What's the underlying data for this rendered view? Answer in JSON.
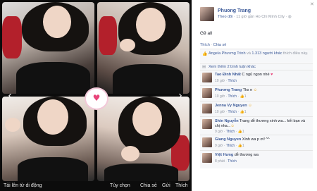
{
  "viewer": {
    "prev_arrow": "‹",
    "next_arrow": "›",
    "toolbar": {
      "title": "Tải lên từ di động",
      "options": "Tùy chọn",
      "share": "Chia sẻ",
      "send": "Gửi",
      "like": "Thích"
    }
  },
  "sidebar": {
    "close": "✕",
    "author": {
      "name": "Phuong Trang",
      "follow": "Theo dõi",
      "meta": " · 11 giờ gần Ho Chi Minh City · "
    },
    "caption": "G9 all",
    "actions": {
      "like": "Thích",
      "share": "Chia sẻ",
      "sep": " · "
    },
    "likes_text_names": "Angela Phương Trinh",
    "likes_text_mid": " và ",
    "likes_text_count": "1.313 người khác",
    "likes_text_end": " thích điều này.",
    "more_comments": "Xem thêm 2 bình luận khác",
    "comments": [
      {
        "author": "Tao Đình Nhất",
        "text": " C ngủ ngon nhé ",
        "emo": "♥",
        "time": "10 giờ",
        "like": "Thích",
        "count": ""
      },
      {
        "author": "Phương Trang",
        "text": " Tks e ",
        "emo": "☺",
        "time": "10 giờ",
        "like": "Thích",
        "count": "1"
      },
      {
        "author": "Jenna Vy Nguyen",
        "text": " ",
        "emo": "☺",
        "time": "10 giờ",
        "like": "Thích",
        "count": "1"
      },
      {
        "author": "Shin Nguyễn",
        "text": " Trang dễ thương xinh wa... kết bạn và chị nha...",
        "emo": "☺",
        "time": "9 giờ",
        "like": "Thích",
        "count": "1"
      },
      {
        "author": "Giang Nguyen",
        "text": " Xinh wa p ơi! ^^",
        "emo": "",
        "time": "9 giờ",
        "like": "Thích",
        "count": "1"
      },
      {
        "author": "Việt Hưng",
        "text": " dễ thương wa",
        "emo": "",
        "time": "8 phút",
        "like": "Thích",
        "count": ""
      }
    ]
  }
}
